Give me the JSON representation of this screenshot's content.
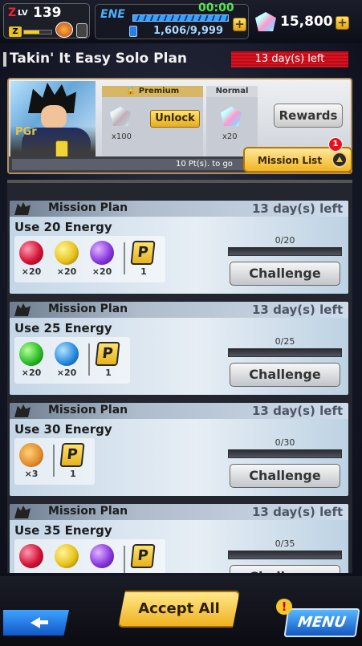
{
  "status": {
    "z_label": "Z",
    "lv_label": "LV",
    "level": "139",
    "z_badge": "Z",
    "xp_fraction": 0.55,
    "ene_label": "ENE",
    "timer": "00:00",
    "energy": "1,606/9,999",
    "energy_fraction": 0.16,
    "gems": "15,800",
    "plus": "+"
  },
  "title": {
    "text": "Takin' It Easy Solo Plan",
    "days_left": "13 day(s) left"
  },
  "plan": {
    "pgr_label": "PGr",
    "premium_label": "Premium",
    "normal_label": "Normal",
    "premium_qty": "x100",
    "normal_qty": "x20",
    "unlock_label": "Unlock",
    "rewards_label": "Rewards",
    "progress_text": "10 Pt(s). to go",
    "mission_list_label": "Mission List",
    "mission_badge": "1"
  },
  "missions": [
    {
      "plan_label": "Mission Plan",
      "days": "13 day(s) left",
      "title": "Use 20 Energy",
      "progress": "0/20",
      "button": "Challenge",
      "items": [
        {
          "type": "red",
          "qty": "×20"
        },
        {
          "type": "yel",
          "qty": "×20"
        },
        {
          "type": "pur",
          "qty": "×20"
        },
        {
          "type": "coin",
          "qty": "1"
        }
      ]
    },
    {
      "plan_label": "Mission Plan",
      "days": "13 day(s) left",
      "title": "Use 25 Energy",
      "progress": "0/25",
      "button": "Challenge",
      "items": [
        {
          "type": "grn",
          "qty": "×20"
        },
        {
          "type": "blu",
          "qty": "×20"
        },
        {
          "type": "coin",
          "qty": "1"
        }
      ]
    },
    {
      "plan_label": "Mission Plan",
      "days": "13 day(s) left",
      "title": "Use 30 Energy",
      "progress": "0/30",
      "button": "Challenge",
      "items": [
        {
          "type": "pizza",
          "qty": "×3"
        },
        {
          "type": "coin",
          "qty": "1"
        }
      ]
    },
    {
      "plan_label": "Mission Plan",
      "days": "13 day(s) left",
      "title": "Use 35 Energy",
      "progress": "0/35",
      "button": "Challenge",
      "items": [
        {
          "type": "red",
          "qty": ""
        },
        {
          "type": "yel",
          "qty": ""
        },
        {
          "type": "pur",
          "qty": ""
        },
        {
          "type": "coin",
          "qty": ""
        }
      ]
    }
  ],
  "coin_letter": "P",
  "bottom": {
    "accept_all": "Accept All",
    "menu": "MENU",
    "menu_alert": "!"
  }
}
